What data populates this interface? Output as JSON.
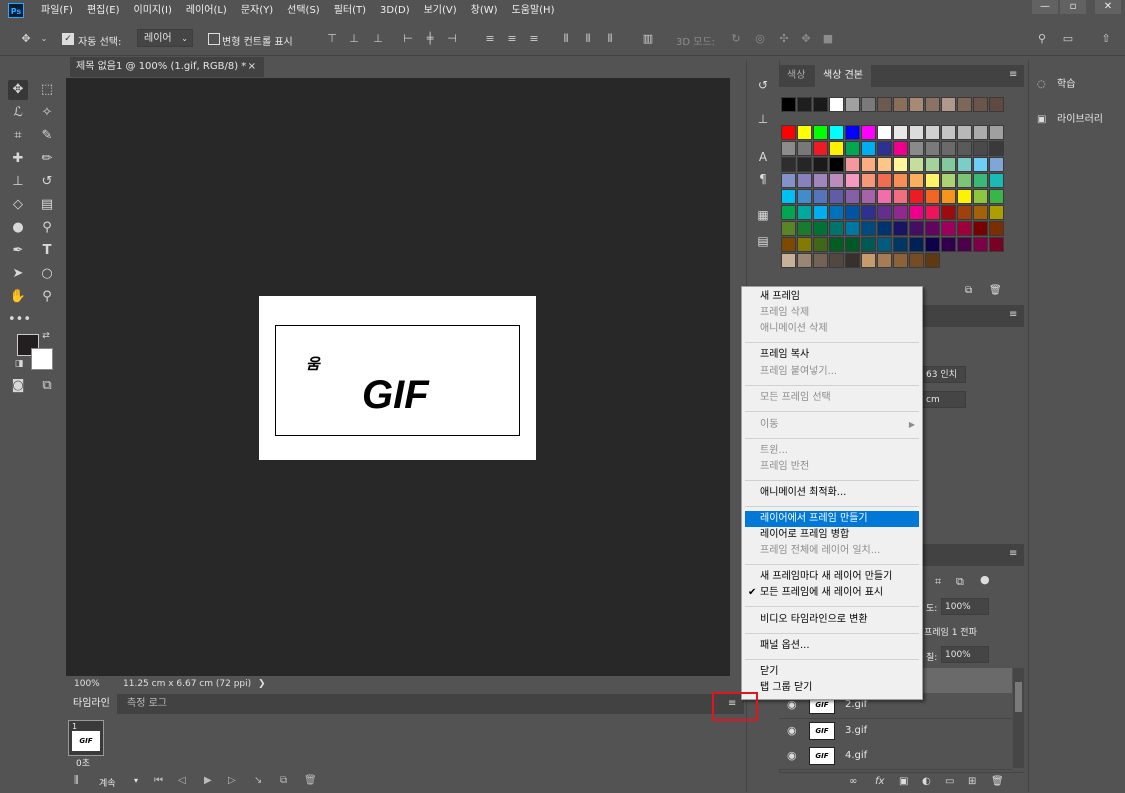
{
  "app": {
    "logo": "Ps"
  },
  "menubar": [
    "파일(F)",
    "편집(E)",
    "이미지(I)",
    "레이어(L)",
    "문자(Y)",
    "선택(S)",
    "필터(T)",
    "3D(D)",
    "보기(V)",
    "창(W)",
    "도움말(H)"
  ],
  "window_buttons": [
    "—",
    "▫",
    "✕"
  ],
  "options": {
    "auto_select_label": "자동 선택:",
    "auto_select_value": "레이어",
    "transform_label": "변형 컨트롤 표시",
    "mode3d_label": "3D 모드:"
  },
  "document": {
    "tab_title": "제목 없음1 @ 100% (1.gif, RGB/8) *",
    "tab_close": "×",
    "canvas_small_text": "움",
    "canvas_big_text": "GIF",
    "zoom": "100%",
    "doc_size": "11.25 cm x 6.67 cm (72 ppi)",
    "status_arrow": "❯"
  },
  "timeline": {
    "tabs": [
      "타임라인",
      "측정 로그"
    ],
    "frame_number": "1",
    "frame_delay": "0초",
    "loop_label": "계속"
  },
  "swatches": {
    "tabs": [
      "색상",
      "색상 견본"
    ],
    "colors": [
      [
        "#000000",
        "#1e1e1e",
        "#1a1a1a",
        "#ffffff",
        "#a0a0a0",
        "#7a7a7a",
        "#6b5a4d",
        "#8b6e5a",
        "#a78a75",
        "#8b7262",
        "#b0988a",
        "#7d6756",
        "#6b5448",
        "#5e4a40"
      ],
      [
        "#ff0000",
        "#ffff00",
        "#00ff00",
        "#00ffff",
        "#0000ff",
        "#ff00ff",
        "#ffffff",
        "#e8e8e8",
        "#dcdcdc",
        "#d0d0d0",
        "#c4c4c4",
        "#b8b8b8",
        "#acacac",
        "#a0a0a0"
      ],
      [
        "#8c8c8c",
        "#787878",
        "#ed1c24",
        "#fff200",
        "#00a651",
        "#00aeef",
        "#2e3192",
        "#ec008c",
        "#8a8a8a",
        "#7a7a7a",
        "#6a6a6a",
        "#5a5a5a",
        "#4a4a4a",
        "#3a3a3a"
      ],
      [
        "#2e2e2e",
        "#262626",
        "#1a1a1a",
        "#000000",
        "#f5989d",
        "#f9ad81",
        "#fdc689",
        "#fff799",
        "#c4df9b",
        "#a3d39c",
        "#82ca9d",
        "#7bcdc8",
        "#6ecff6",
        "#7ea7d8"
      ],
      [
        "#8393ca",
        "#8781bd",
        "#a186be",
        "#bd8cbf",
        "#f49ac1",
        "#f7977a",
        "#f26c4f",
        "#f68e55",
        "#fbaf5c",
        "#fff467",
        "#acd372",
        "#7cc576",
        "#3bb878",
        "#1abbb4"
      ],
      [
        "#00bff3",
        "#438ccb",
        "#5574b9",
        "#605ca8",
        "#8560a8",
        "#a763a8",
        "#f06ea9",
        "#f26d7d",
        "#ed1c24",
        "#f26522",
        "#f7941d",
        "#fff200",
        "#8dc63f",
        "#39b54a"
      ],
      [
        "#00a651",
        "#00a99d",
        "#00aeef",
        "#0072bc",
        "#0054a6",
        "#2e3192",
        "#662d91",
        "#92278f",
        "#ec008c",
        "#ed145b",
        "#9e0b0f",
        "#a0410d",
        "#a3620a",
        "#aba000"
      ],
      [
        "#598527",
        "#197b30",
        "#007236",
        "#00746b",
        "#0076a3",
        "#004a80",
        "#003471",
        "#1b1464",
        "#440e62",
        "#630460",
        "#9e005d",
        "#9e0039",
        "#790000",
        "#7b2e00"
      ],
      [
        "#7d4900",
        "#827b00",
        "#406618",
        "#005e20",
        "#005826",
        "#005952",
        "#005b7f",
        "#003663",
        "#002157",
        "#0d004c",
        "#32004b",
        "#4b0049",
        "#7b0046",
        "#7a0026"
      ],
      [
        "#c7b299",
        "#998675",
        "#736357",
        "#534741",
        "#37302d",
        "#c69c6d",
        "#a67c52",
        "#8c6239",
        "#754c24",
        "#603913"
      ]
    ]
  },
  "rightcol": {
    "learn": "학습",
    "library": "라이브러리"
  },
  "properties": {
    "width_value": "63 인치",
    "height_value": "cm"
  },
  "layers": {
    "opacity_label": "도:",
    "opacity_value": "100%",
    "frame_text": "프레임 1 전파",
    "fill_label": "칠:",
    "fill_value": "100%",
    "rows": [
      {
        "name": "2.gif",
        "thumb": "GIF"
      },
      {
        "name": "3.gif",
        "thumb": "GIF"
      },
      {
        "name": "4.gif",
        "thumb": "GIF"
      }
    ],
    "bottom_icons": [
      "∞",
      "fx",
      "▣",
      "◐",
      "▭",
      "⊞",
      "🗑"
    ]
  },
  "context_menu": {
    "items": [
      {
        "label": "새 프레임",
        "enabled": true
      },
      {
        "label": "프레임 삭제",
        "enabled": false
      },
      {
        "label": "애니메이션 삭제",
        "enabled": false
      },
      {
        "label": "프레임 복사",
        "enabled": true
      },
      {
        "label": "프레임 붙여넣기...",
        "enabled": false
      },
      {
        "label": "모든 프레임 선택",
        "enabled": false
      },
      {
        "label": "이동",
        "enabled": false,
        "submenu": true
      },
      {
        "label": "트윈...",
        "enabled": false
      },
      {
        "label": "프레임 반전",
        "enabled": false
      },
      {
        "label": "애니메이션 최적화...",
        "enabled": true
      },
      {
        "label": "레이어에서 프레임 만들기",
        "enabled": true,
        "highlighted": true
      },
      {
        "label": "레이어로 프레임 병합",
        "enabled": true
      },
      {
        "label": "프레임 전체에 레이어 일치...",
        "enabled": false
      },
      {
        "label": "새 프레임마다 새 레이어 만들기",
        "enabled": true
      },
      {
        "label": "모든 프레임에 새 레이어 표시",
        "enabled": true,
        "checked": true
      },
      {
        "label": "비디오 타임라인으로 변환",
        "enabled": true
      },
      {
        "label": "패널 옵션...",
        "enabled": true
      },
      {
        "label": "닫기",
        "enabled": true
      },
      {
        "label": "탭 그룹 닫기",
        "enabled": true
      }
    ]
  },
  "colors": {
    "highlight": "#0078d7",
    "annotation_box": "#e1151e",
    "canvas_bg": "#282828",
    "panel_bg": "#535353"
  }
}
